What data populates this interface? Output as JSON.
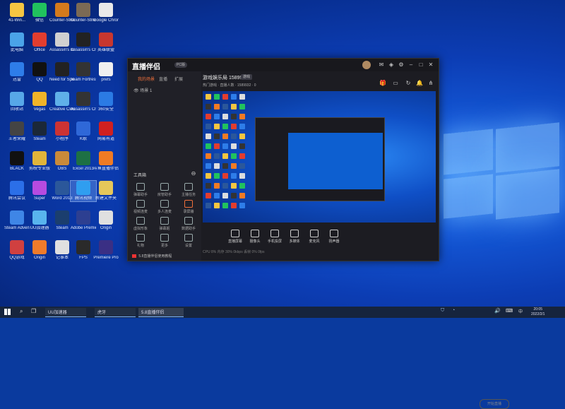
{
  "desktop": {
    "icons": [
      {
        "label": "41-Win...",
        "color": "#f5c542"
      },
      {
        "label": "微信",
        "color": "#21c25e"
      },
      {
        "label": "Counter-Strike 2",
        "color": "#d47a1c"
      },
      {
        "label": "Counter-Strike 2",
        "color": "#7b6a55"
      },
      {
        "label": "Google Chrome",
        "color": "#e9e9e9"
      },
      {
        "label": "此电脑",
        "color": "#4aa3e8"
      },
      {
        "label": "Office",
        "color": "#e23d2f"
      },
      {
        "label": "Assassin's Creed",
        "color": "#d0d0d0"
      },
      {
        "label": "Assassin's Creed Syn",
        "color": "#222"
      },
      {
        "label": "英雄联盟",
        "color": "#c8372f"
      },
      {
        "label": "迅雷",
        "color": "#2e7de9"
      },
      {
        "label": "QQ",
        "color": "#111"
      },
      {
        "label": "Need for Speed",
        "color": "#222"
      },
      {
        "label": "Team Fortress 2",
        "color": "#333"
      },
      {
        "label": "prefs",
        "color": "#f0f0f0"
      },
      {
        "label": "回收站",
        "color": "#57a8e8"
      },
      {
        "label": "Vegas",
        "color": "#f0b429"
      },
      {
        "label": "Creative Cloud",
        "color": "#5fb0e8"
      },
      {
        "label": "Assassin's Creed",
        "color": "#333"
      },
      {
        "label": "360安全",
        "color": "#2b7be4"
      },
      {
        "label": "王者荣耀",
        "color": "#444"
      },
      {
        "label": "Steam",
        "color": "#1b2838"
      },
      {
        "label": "小程序",
        "color": "#cc3333"
      },
      {
        "label": "K歌",
        "color": "#2f68d8"
      },
      {
        "label": "网易有道",
        "color": "#d02020"
      },
      {
        "label": "BLACK",
        "color": "#111"
      },
      {
        "label": "剪映专业版",
        "color": "#e0b43a"
      },
      {
        "label": "OBS",
        "color": "#c98a3a"
      },
      {
        "label": "Excel 2013",
        "color": "#1d7044"
      },
      {
        "label": "斗鱼直播伴侣",
        "color": "#f07b24"
      },
      {
        "label": "腾讯会议",
        "color": "#2b6fe8"
      },
      {
        "label": "Super",
        "color": "#b64be0"
      },
      {
        "label": "Word 2013",
        "color": "#2b579a"
      },
      {
        "label": "腾讯视频",
        "color": "#2f9ef0"
      },
      {
        "label": "新建文件夹",
        "color": "#e6c75a"
      },
      {
        "label": "Steam Adventure",
        "color": "#3f86e6"
      },
      {
        "label": "UU加速器",
        "color": "#58b4ee"
      },
      {
        "label": "Steam",
        "color": "#1b3e6e"
      },
      {
        "label": "Adobe Premiere",
        "color": "#2d3f91"
      },
      {
        "label": "Origin",
        "color": "#e0e0e0"
      },
      {
        "label": "QQ游戏",
        "color": "#d04040"
      },
      {
        "label": "Origin",
        "color": "#f07b2a"
      },
      {
        "label": "记事本",
        "color": "#e0e0e0"
      },
      {
        "label": "FPS",
        "color": "#2a2a2a"
      },
      {
        "label": "Premiere Pro",
        "color": "#3a2f84"
      }
    ]
  },
  "app": {
    "logo_text": "直播伴侣",
    "version_badge": "PC版",
    "tabs": [
      "我的场景",
      "直播",
      "扩展"
    ],
    "scene_label": "场景 1",
    "stream_title": "游戏娱乐局 1589932",
    "stream_tag": "游戏",
    "stream_sub": "热门游戏 · 直播人数 · 1589932 · 0",
    "tools_title": "工具箱",
    "tools": [
      {
        "label": "弹幕助手"
      },
      {
        "label": "房管助手"
      },
      {
        "label": "主播任务"
      },
      {
        "label": "视频连麦"
      },
      {
        "label": "多人连麦"
      },
      {
        "label": "录屏播"
      },
      {
        "label": "虚拟形象"
      },
      {
        "label": "弹幕姬"
      },
      {
        "label": "数据助手"
      },
      {
        "label": "礼物"
      },
      {
        "label": "更多"
      },
      {
        "label": "设置"
      }
    ],
    "bottom_note": "5.8直播伴侣使用教程",
    "controls": [
      {
        "label": "直播屏幕"
      },
      {
        "label": "摄像头"
      },
      {
        "label": "手机投屏"
      },
      {
        "label": "多媒体"
      },
      {
        "label": "麦克风"
      },
      {
        "label": "扬声器"
      }
    ],
    "start_button": "开始直播",
    "status_text": "CPU 8%   内存 30%   0kbps   丢帧 0%   0fps"
  },
  "taskbar": {
    "items": [
      {
        "label": "UU加速器"
      },
      {
        "label": "虎牙"
      },
      {
        "label": "5.8直播伴侣"
      }
    ],
    "time": "20:05",
    "date": "2022/2/1"
  }
}
